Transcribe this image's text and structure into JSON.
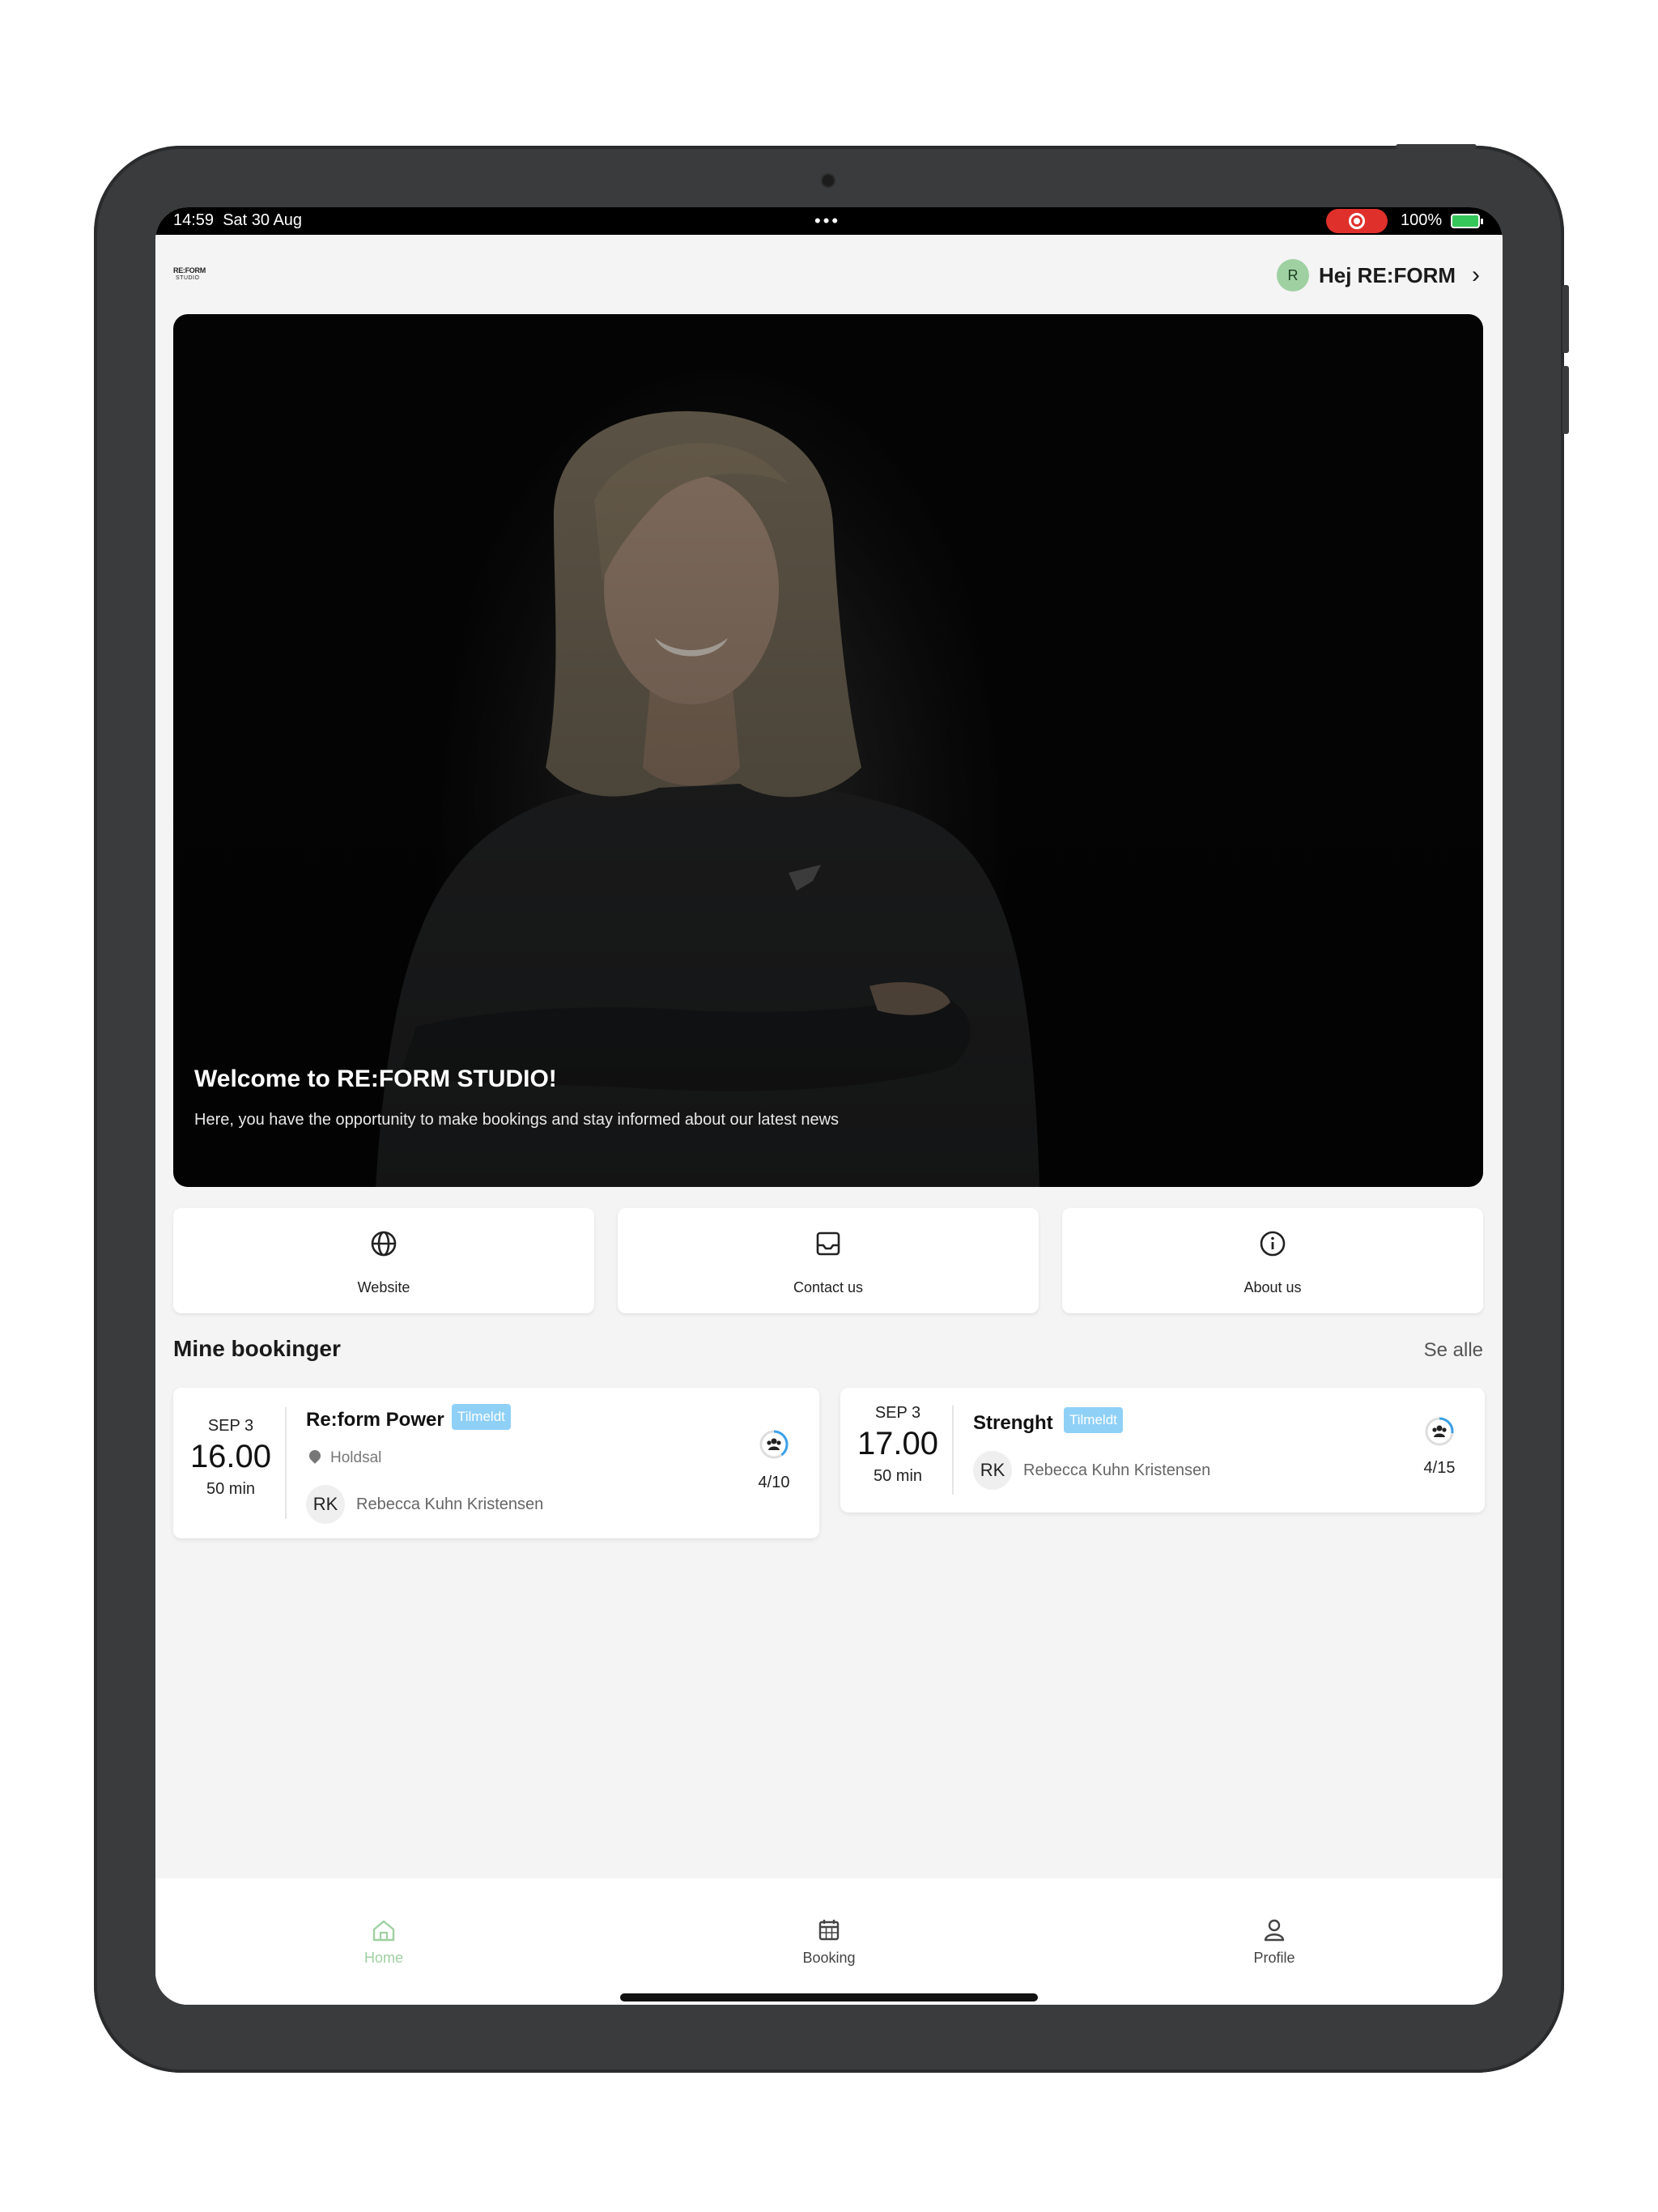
{
  "status_bar": {
    "time": "14:59",
    "date": "Sat 30 Aug",
    "dots": "•••",
    "battery": "100%"
  },
  "header": {
    "logo_line1": "RE:FORM",
    "logo_line2": "STUDIO",
    "avatar_initial": "R",
    "greeting": "Hej RE:FORM"
  },
  "hero": {
    "title": "Welcome to RE:FORM STUDIO!",
    "subtitle": "Here, you have the opportunity to make bookings and stay informed about our latest news"
  },
  "quick_links": [
    {
      "label": "Website",
      "icon": "globe-icon"
    },
    {
      "label": "Contact us",
      "icon": "inbox-icon"
    },
    {
      "label": "About us",
      "icon": "info-icon"
    }
  ],
  "bookings": {
    "title": "Mine bookinger",
    "see_all": "Se alle",
    "items": [
      {
        "month_day": "SEP 3",
        "time": "16.00",
        "duration": "50 min",
        "name": "Re:form Power",
        "status": "Tilmeldt",
        "location": "Holdsal",
        "instructor_initials": "RK",
        "instructor": "Rebecca Kuhn Kristensen",
        "capacity": "4/10",
        "capacity_fraction": 0.4
      },
      {
        "month_day": "SEP 3",
        "time": "17.00",
        "duration": "50 min",
        "name": "Strenght",
        "status": "Tilmeldt",
        "instructor_initials": "RK",
        "instructor": "Rebecca Kuhn Kristensen",
        "capacity": "4/15",
        "capacity_fraction": 0.27
      }
    ]
  },
  "tabbar": {
    "items": [
      {
        "label": "Home",
        "active": true
      },
      {
        "label": "Booking",
        "active": false
      },
      {
        "label": "Profile",
        "active": false
      }
    ]
  },
  "colors": {
    "accent_active": "#9fd0a2",
    "tag": "#8fd0f7",
    "recording": "#e0302c"
  }
}
